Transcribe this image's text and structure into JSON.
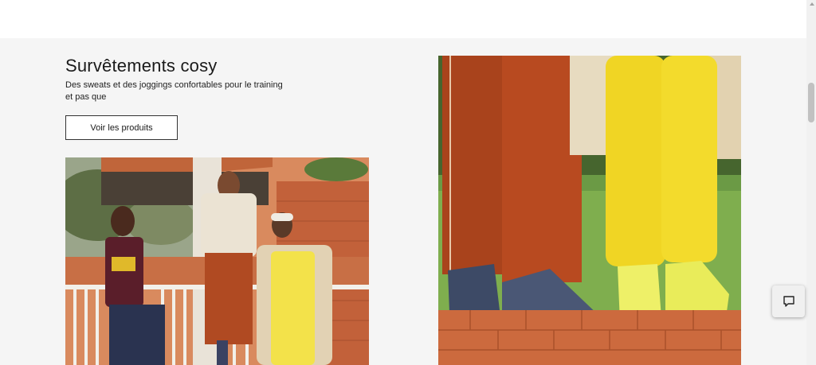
{
  "section": {
    "title": "Survêtements cosy",
    "description": "Des sweats et des joggings confortables pour le training et pas que",
    "cta_label": "Voir les produits"
  },
  "colors": {
    "section_bg": "#f5f5f5",
    "text": "#1a1a1a",
    "button_border": "#333333"
  },
  "images": {
    "left": "people-in-tracksuits-photo",
    "right": "sneakers-on-brick-wall-photo"
  },
  "widgets": {
    "chat_icon": "chat-bubble-icon"
  }
}
